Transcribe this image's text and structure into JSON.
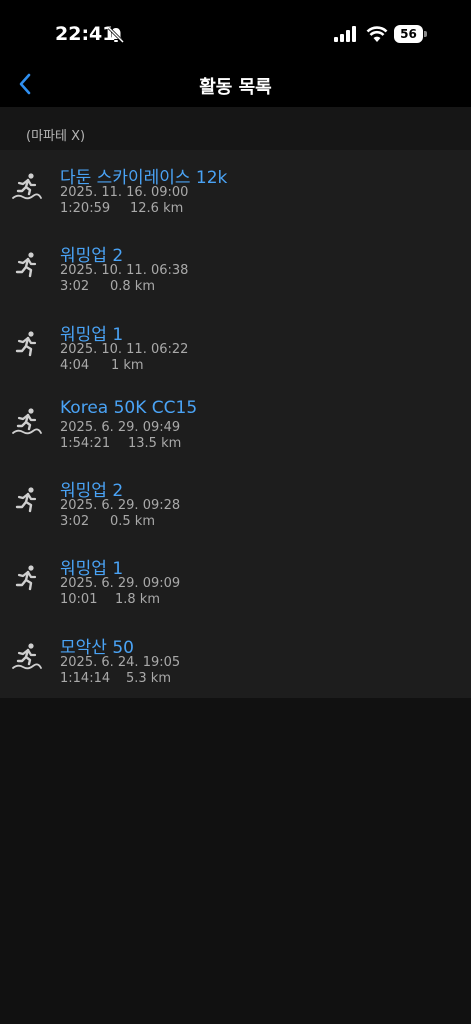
{
  "status_bar": {
    "time": "22:41",
    "battery": "56"
  },
  "nav": {
    "title": "활동 목록"
  },
  "section": {
    "label": "(마파테 X)"
  },
  "activities": [
    {
      "title": "다둔 스카이레이스 12k",
      "date": "2025. 11. 16. 09:00",
      "duration": "1:20:59",
      "distance": "12.6 km",
      "icon": "trail-run-icon"
    },
    {
      "title": "워밍업 2",
      "date": "2025. 10. 11. 06:38",
      "duration": "3:02",
      "distance": "0.8 km",
      "icon": "run-icon"
    },
    {
      "title": "워밍업 1",
      "date": "2025. 10. 11. 06:22",
      "duration": "4:04",
      "distance": "1 km",
      "icon": "run-icon"
    },
    {
      "title": "Korea 50K CC15",
      "date": "2025. 6. 29. 09:49",
      "duration": "1:54:21",
      "distance": "13.5 km",
      "icon": "trail-run-icon"
    },
    {
      "title": "워밍업 2",
      "date": "2025. 6. 29. 09:28",
      "duration": "3:02",
      "distance": "0.5 km",
      "icon": "run-icon"
    },
    {
      "title": "워밍업 1",
      "date": "2025. 6. 29. 09:09",
      "duration": "10:01",
      "distance": "1.8 km",
      "icon": "run-icon"
    },
    {
      "title": "모악산 50",
      "date": "2025. 6. 24. 19:05",
      "duration": "1:14:14",
      "distance": "5.3 km",
      "icon": "trail-run-icon"
    }
  ]
}
